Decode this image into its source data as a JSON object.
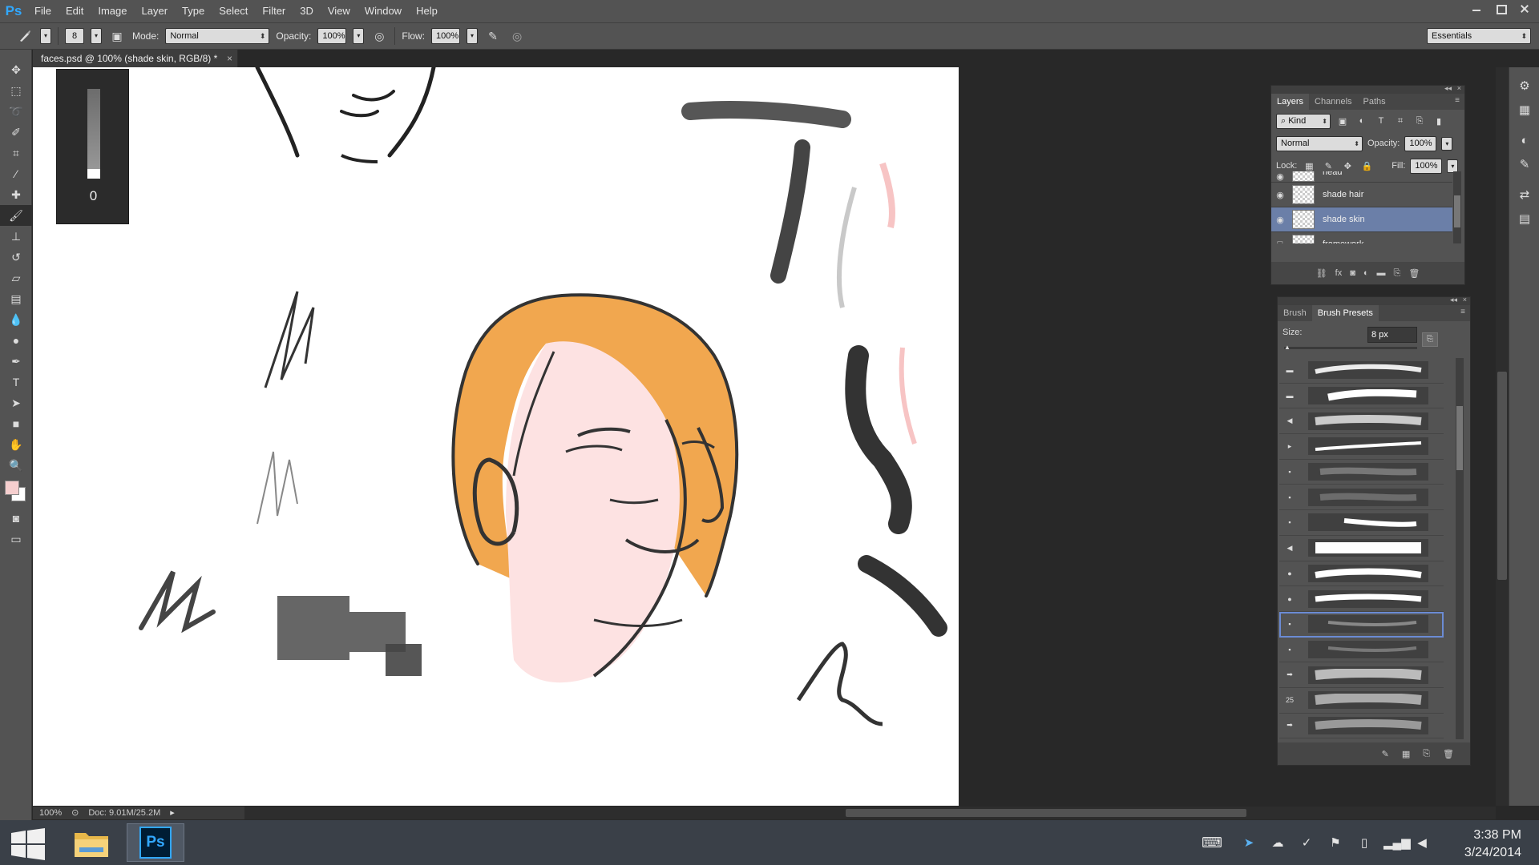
{
  "app": {
    "logo": "Ps",
    "menus": [
      "File",
      "Edit",
      "Image",
      "Layer",
      "Type",
      "Select",
      "Filter",
      "3D",
      "View",
      "Window",
      "Help"
    ]
  },
  "options": {
    "brush_size": "8",
    "mode_label": "Mode:",
    "mode_value": "Normal",
    "opacity_label": "Opacity:",
    "opacity_value": "100%",
    "flow_label": "Flow:",
    "flow_value": "100%",
    "workspace": "Essentials"
  },
  "document": {
    "tab_title": "faces.psd @ 100% (shade skin, RGB/8) *",
    "brush_size_overlay": "0",
    "zoom": "100%",
    "doc_info": "Doc: 9.01M/25.2M"
  },
  "tools": [
    "move-icon",
    "marquee-icon",
    "lasso-icon",
    "quick-select-icon",
    "crop-icon",
    "eyedropper-icon",
    "healing-icon",
    "brush-icon",
    "stamp-icon",
    "history-brush-icon",
    "eraser-icon",
    "gradient-icon",
    "blur-icon",
    "dodge-icon",
    "pen-icon",
    "type-icon",
    "path-select-icon",
    "shape-icon",
    "hand-icon",
    "zoom-icon"
  ],
  "colors": {
    "foreground": "#f6cfcf",
    "background": "#ffffff",
    "hair": "#f0a040",
    "skin": "#fde2e2",
    "accent": "#31a8ff"
  },
  "layers_panel": {
    "tabs": [
      "Layers",
      "Channels",
      "Paths"
    ],
    "filter_label": "Kind",
    "blend_mode": "Normal",
    "opacity_label": "Opacity:",
    "opacity_value": "100%",
    "lock_label": "Lock:",
    "fill_label": "Fill:",
    "fill_value": "100%",
    "layers": [
      {
        "name": "head",
        "visible": true
      },
      {
        "name": "shade hair",
        "visible": true
      },
      {
        "name": "shade skin",
        "visible": true,
        "selected": true
      },
      {
        "name": "framework",
        "visible": false
      }
    ]
  },
  "brush_panel": {
    "tabs": [
      "Brush",
      "Brush Presets"
    ],
    "size_label": "Size:",
    "size_value": "8 px",
    "preset_number": "25"
  },
  "taskbar": {
    "time": "3:38 PM",
    "date": "3/24/2014",
    "ps_label": "Ps"
  }
}
